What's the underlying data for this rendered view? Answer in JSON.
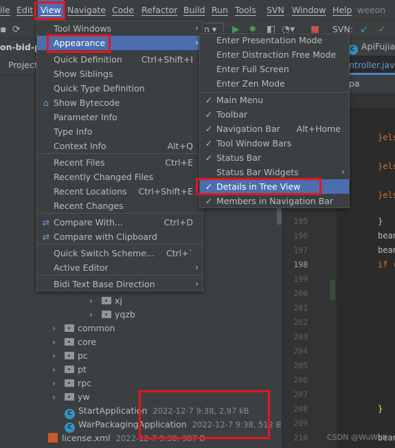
{
  "menubar": {
    "items": [
      "ile",
      "Edit",
      "View",
      "Navigate",
      "Code",
      "Refactor",
      "Build",
      "Run",
      "Tools",
      "SVN",
      "Window",
      "Help"
    ],
    "project": "weeon",
    "active": "View"
  },
  "toolbar": {
    "run_config": "n",
    "svn_label": "SVN:"
  },
  "project_panel": {
    "project_name": "on-bid-pl",
    "tab": "Project"
  },
  "view_menu": {
    "items": [
      {
        "label": "Tool Windows",
        "submenu": true
      },
      {
        "label": "Appearance",
        "submenu": true,
        "selected": true
      },
      {
        "label": "Quick Definition",
        "shortcut": "Ctrl+Shift+I"
      },
      {
        "label": "Show Siblings"
      },
      {
        "label": "Quick Type Definition"
      },
      {
        "label": "Show Bytecode",
        "icon": "bytecode-icon"
      },
      {
        "label": "Parameter Info"
      },
      {
        "label": "Type Info"
      },
      {
        "label": "Context Info",
        "shortcut": "Alt+Q"
      },
      {
        "label": "Recent Files",
        "shortcut": "Ctrl+E"
      },
      {
        "label": "Recently Changed Files"
      },
      {
        "label": "Recent Locations",
        "shortcut": "Ctrl+Shift+E"
      },
      {
        "label": "Recent Changes"
      },
      {
        "label": "Compare With...",
        "shortcut": "Ctrl+D",
        "icon": "compare-icon"
      },
      {
        "label": "Compare with Clipboard",
        "icon": "clipboard-compare-icon"
      },
      {
        "label": "Quick Switch Scheme...",
        "shortcut": "Ctrl+`"
      },
      {
        "label": "Active Editor",
        "submenu": true
      },
      {
        "label": "Bidi Text Base Direction",
        "submenu": true
      }
    ]
  },
  "appearance_menu": {
    "items": [
      {
        "label": "Enter Presentation Mode"
      },
      {
        "label": "Enter Distraction Free Mode"
      },
      {
        "label": "Enter Full Screen"
      },
      {
        "label": "Enter Zen Mode"
      },
      {
        "label": "Main Menu",
        "checked": true
      },
      {
        "label": "Toolbar",
        "checked": true
      },
      {
        "label": "Navigation Bar",
        "checked": true,
        "shortcut": "Alt+Home"
      },
      {
        "label": "Tool Window Bars",
        "checked": true
      },
      {
        "label": "Status Bar",
        "checked": true
      },
      {
        "label": "Status Bar Widgets",
        "submenu": true
      },
      {
        "label": "Details in Tree View",
        "checked": true,
        "selected": true
      },
      {
        "label": "Members in Navigation Bar",
        "checked": true
      }
    ]
  },
  "tree": [
    {
      "label": "xj",
      "type": "folder"
    },
    {
      "label": "yqzb",
      "type": "folder"
    },
    {
      "label": "common",
      "type": "folder"
    },
    {
      "label": "core",
      "type": "folder"
    },
    {
      "label": "pc",
      "type": "folder"
    },
    {
      "label": "pt",
      "type": "folder"
    },
    {
      "label": "rpc",
      "type": "folder"
    },
    {
      "label": "yw",
      "type": "folder"
    },
    {
      "label": "StartApplication",
      "type": "class",
      "meta": "2022-12-7 9:38, 2.97 kB"
    },
    {
      "label": "WarPackagingApplication",
      "type": "class",
      "meta": "2022-12-7 9:38, 512 B"
    },
    {
      "label": "license.xml",
      "type": "xml",
      "meta": "2022-12-7 9:38, 387 B"
    }
  ],
  "editor": {
    "tabs": [
      "ApiFujian",
      "ntroller.java"
    ],
    "breadcrumb": "pa",
    "lines": [
      {
        "n": "195",
        "code": "}"
      },
      {
        "n": "196",
        "code": "bean"
      },
      {
        "n": "197",
        "code": "bean"
      },
      {
        "n": "198",
        "code": "if ("
      },
      {
        "n": "199",
        "code": ""
      },
      {
        "n": "200",
        "code": ""
      },
      {
        "n": "201",
        "code": ""
      },
      {
        "n": "202",
        "code": ""
      },
      {
        "n": "203",
        "code": ""
      },
      {
        "n": "204",
        "code": ""
      },
      {
        "n": "205",
        "code": ""
      },
      {
        "n": "206",
        "code": ""
      },
      {
        "n": "207",
        "code": ""
      },
      {
        "n": "208",
        "code": "}"
      },
      {
        "n": "209",
        "code": ""
      },
      {
        "n": "210",
        "code": "bean"
      }
    ],
    "else_text": "}els"
  },
  "watermark": "CSDN @WuWuII"
}
